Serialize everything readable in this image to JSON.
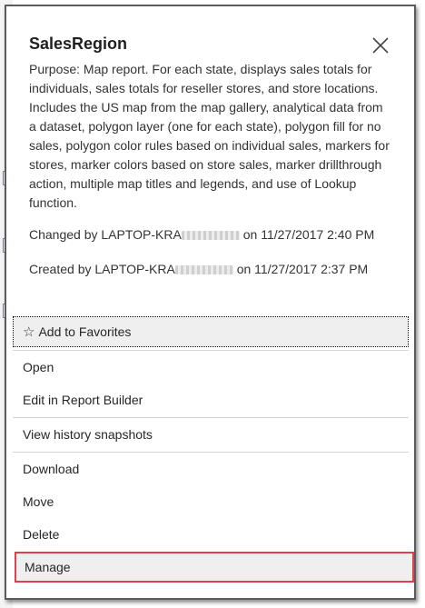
{
  "panel": {
    "title": "SalesRegion",
    "description": "Purpose: Map report. For each state, displays sales totals for individuals, sales totals for reseller stores, and store locations. Includes the US map from the map gallery, analytical data from a dataset, polygon layer (one for each state), polygon fill for no sales, polygon color rules based on individual sales, markers for stores, marker colors based on store sales, marker drillthrough action, multiple map titles and legends, and use of Lookup function.",
    "changed_prefix": "Changed by LAPTOP-KRA",
    "changed_suffix": "on 11/27/2017 2:40 PM",
    "created_prefix": "Created by LAPTOP-KRA",
    "created_suffix": "on 11/27/2017 2:37 PM"
  },
  "menu": {
    "favorites": "Add to Favorites",
    "open": "Open",
    "edit": "Edit in Report Builder",
    "history": "View history snapshots",
    "download": "Download",
    "move": "Move",
    "delete": "Delete",
    "manage": "Manage"
  },
  "colors": {
    "highlight_border": "#e0414b",
    "menu_hover": "#efefef"
  }
}
